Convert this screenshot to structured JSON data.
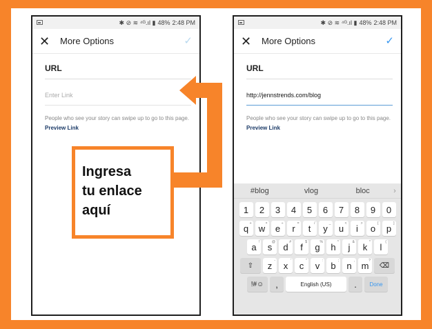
{
  "colors": {
    "frame": "#F7842A",
    "accent": "#3897f0"
  },
  "status_bar": {
    "time": "2:48 PM",
    "battery": "48%",
    "icons": "✱ ⊘ ≋ ⁴ᴳ.ıl ▮"
  },
  "screen": {
    "close_icon": "✕",
    "check_icon": "✓",
    "title": "More Options",
    "url_label": "URL",
    "help_text": "People who see your story can swipe up to go to this page.",
    "preview_link": "Preview Link"
  },
  "left_phone": {
    "link_placeholder": "Enter Link"
  },
  "right_phone": {
    "link_value": "http://jennstrends.com/blog"
  },
  "callout": {
    "lines": [
      "Ingresa",
      "tu enlace",
      "aquí"
    ]
  },
  "keyboard": {
    "suggestions": [
      "#blog",
      "vlog",
      "bloc",
      "›"
    ],
    "number_row": [
      "1",
      "2",
      "3",
      "4",
      "5",
      "6",
      "7",
      "8",
      "9",
      "0"
    ],
    "row1": {
      "keys": [
        "q",
        "w",
        "e",
        "r",
        "t",
        "y",
        "u",
        "i",
        "o",
        "p"
      ],
      "hints": [
        "+",
        "×",
        "÷",
        "=",
        "/",
        "_",
        "<",
        ">",
        "[",
        "]"
      ]
    },
    "row2": {
      "keys": [
        "a",
        "s",
        "d",
        "f",
        "g",
        "h",
        "j",
        "k",
        "l"
      ],
      "hints": [
        "!",
        "@",
        "#",
        "$",
        "%",
        "^",
        "&",
        "*",
        "("
      ]
    },
    "row3": {
      "shift": "⇧",
      "keys": [
        "z",
        "x",
        "c",
        "v",
        "b",
        "n",
        "m"
      ],
      "hints": [
        "-",
        "'",
        "\"",
        ":",
        ";",
        ",",
        "?"
      ],
      "backspace": "⌫"
    },
    "row4": {
      "symbols": "!#☺",
      "comma": ",",
      "space": "English (US)",
      "period": ".",
      "done": "Done"
    }
  }
}
